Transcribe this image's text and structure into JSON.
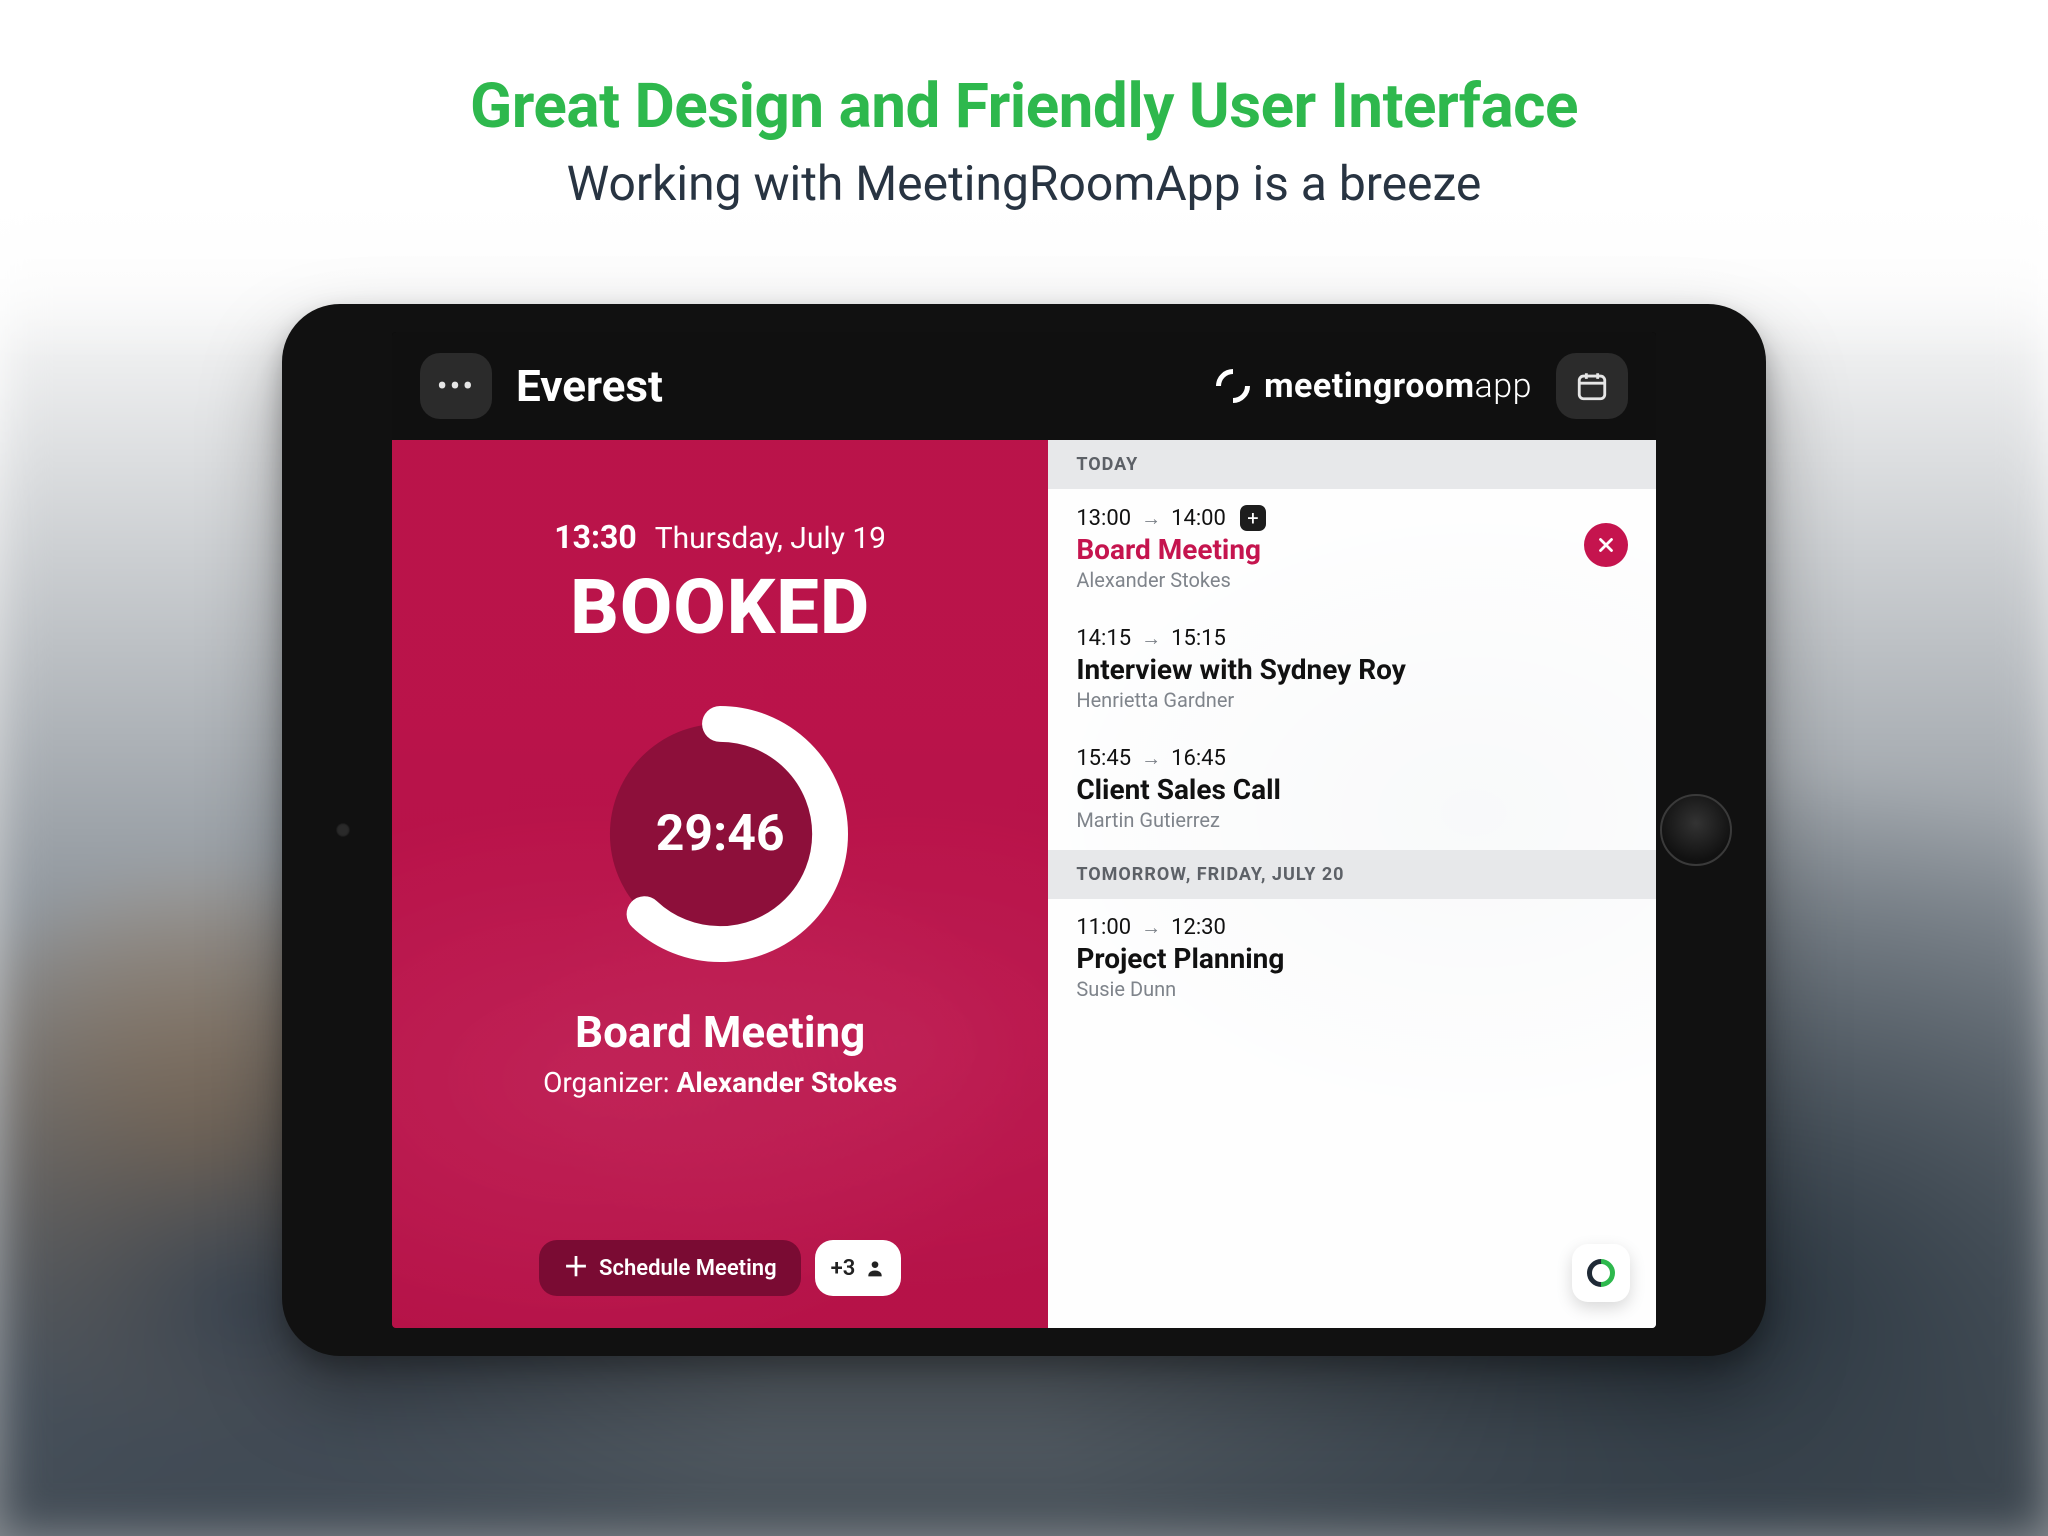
{
  "headline": {
    "title": "Great Design and Friendly User Interface",
    "subtitle": "Working with MeetingRoomApp is a breeze"
  },
  "topbar": {
    "room_name": "Everest",
    "brand_prefix": "meetingroom",
    "brand_suffix": "app"
  },
  "status": {
    "time": "13:30",
    "date": "Thursday, July 19",
    "state": "BOOKED",
    "countdown": "29:46",
    "progress_pct": 62,
    "meeting_title": "Board Meeting",
    "organizer_label": "Organizer:",
    "organizer_name": "Alexander Stokes",
    "schedule_label": "Schedule Meeting",
    "attendee_extra": "+3"
  },
  "agenda": {
    "sections": [
      {
        "label": "TODAY",
        "events": [
          {
            "start": "13:00",
            "end": "14:00",
            "title": "Board Meeting",
            "person": "Alexander Stokes",
            "current": true,
            "has_add": true
          },
          {
            "start": "14:15",
            "end": "15:15",
            "title": "Interview with Sydney Roy",
            "person": "Henrietta Gardner",
            "current": false,
            "has_add": false
          },
          {
            "start": "15:45",
            "end": "16:45",
            "title": "Client Sales Call",
            "person": "Martin Gutierrez",
            "current": false,
            "has_add": false
          }
        ]
      },
      {
        "label": "TOMORROW, FRIDAY, JULY 20",
        "events": [
          {
            "start": "11:00",
            "end": "12:30",
            "title": "Project Planning",
            "person": "Susie Dunn",
            "current": false,
            "has_add": false
          }
        ]
      }
    ]
  },
  "colors": {
    "accent_green": "#2eb84d",
    "accent_magenta": "#c5144e",
    "text_dark": "#283442"
  }
}
